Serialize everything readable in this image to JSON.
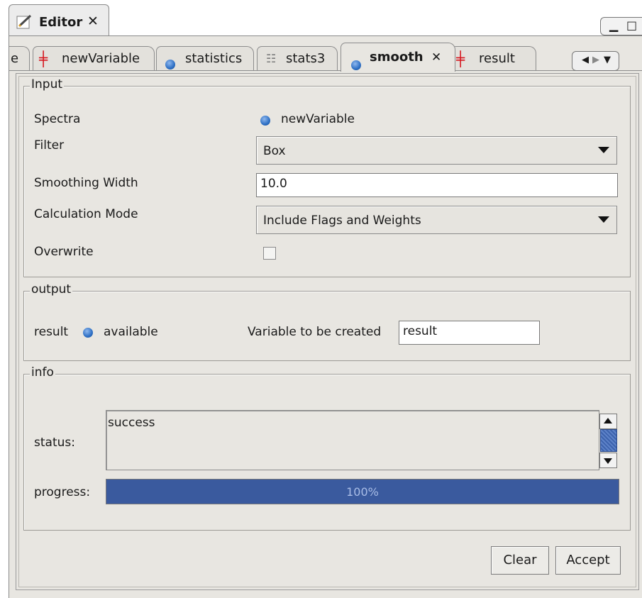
{
  "view": {
    "title": "Editor",
    "close_glyph": "✕",
    "minimize_glyph": "▁",
    "maximize_glyph": "□"
  },
  "tabs": [
    {
      "label": "e",
      "icon": "",
      "active": false
    },
    {
      "label": "newVariable",
      "icon": "variable-cross-icon",
      "active": false
    },
    {
      "label": "statistics",
      "icon": "blue-dot-icon",
      "active": false
    },
    {
      "label": "stats3",
      "icon": "stats-table-icon",
      "active": false
    },
    {
      "label": "smooth",
      "icon": "blue-dot-icon",
      "active": true,
      "close": "✕"
    },
    {
      "label": "result",
      "icon": "variable-cross-icon",
      "active": false
    }
  ],
  "tab_nav": {
    "left": "◀",
    "right": "▶",
    "menu": "▼"
  },
  "input": {
    "legend": "Input",
    "spectra_label": "Spectra",
    "spectra_value": "newVariable",
    "filter_label": "Filter",
    "filter_value": "Box",
    "width_label": "Smoothing Width",
    "width_value": "10.0",
    "mode_label": "Calculation Mode",
    "mode_value": "Include Flags and Weights",
    "overwrite_label": "Overwrite",
    "overwrite_checked": false
  },
  "output": {
    "legend": "output",
    "result_label": "result",
    "available_label": "available",
    "create_label": "Variable to be created",
    "create_value": "result"
  },
  "info": {
    "legend": "info",
    "status_label": "status:",
    "status_value": "success",
    "progress_label": "progress:",
    "progress_text": "100%",
    "progress_value": 1.0
  },
  "buttons": {
    "clear": "Clear",
    "accept": "Accept"
  },
  "colors": {
    "accent": "#3a5a9e",
    "icon_red": "#d6141c",
    "icon_blue": "#2d6fc4"
  }
}
